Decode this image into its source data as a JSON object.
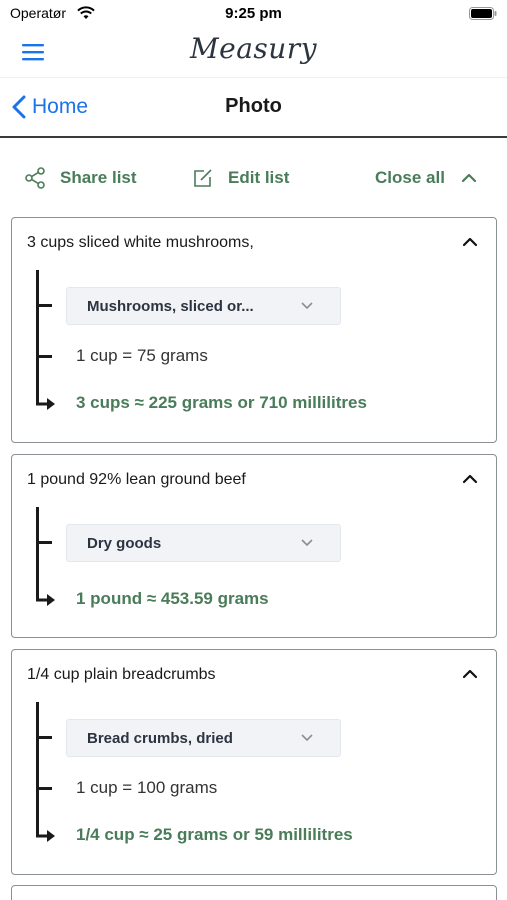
{
  "status_bar": {
    "carrier": "Operatør",
    "time": "9:25 pm"
  },
  "app_bar": {
    "logo": "Measury"
  },
  "nav": {
    "back_label": "Home",
    "title": "Photo"
  },
  "toolbar": {
    "share_label": "Share list",
    "edit_label": "Edit list",
    "close_label": "Close all"
  },
  "colors": {
    "accent_green": "#4a7c59",
    "link_blue": "#1a73e8"
  },
  "cards": [
    {
      "ingredient": "3 cups sliced white mushrooms,",
      "selection": "Mushrooms, sliced or...",
      "ratio": "1 cup = 75 grams",
      "result": "3 cups ≈ 225 grams or 710 millilitres"
    },
    {
      "ingredient": "1 pound 92% lean ground beef",
      "selection": "Dry goods",
      "result": "1 pound ≈ 453.59 grams"
    },
    {
      "ingredient": "1/4 cup plain breadcrumbs",
      "selection": "Bread crumbs, dried",
      "ratio": "1 cup = 100 grams",
      "result": "1/4 cup ≈ 25 grams or 59 millilitres"
    }
  ]
}
